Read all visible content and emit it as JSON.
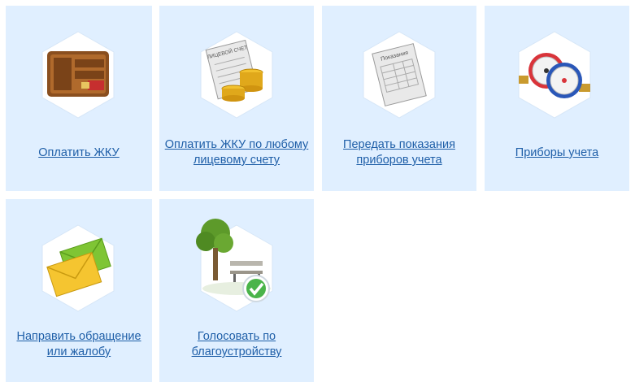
{
  "tiles": [
    {
      "label": "Оплатить ЖКУ",
      "icon": "wallet-icon"
    },
    {
      "label": "Оплатить ЖКУ по любому лицевому счету",
      "icon": "account-coins-icon",
      "icon_text": "ЛИЦЕВОЙ СЧЕТ"
    },
    {
      "label": "Передать показания приборов учета",
      "icon": "meter-readings-form-icon",
      "icon_text": "Показания"
    },
    {
      "label": "Приборы учета",
      "icon": "water-meters-icon"
    },
    {
      "label": "Направить обращение или жалобу",
      "icon": "envelopes-icon"
    },
    {
      "label": "Голосовать по благоустройству",
      "icon": "park-vote-icon"
    }
  ],
  "colors": {
    "tile_bg": "#e0efff",
    "link": "#1f5fa8",
    "hex_bg": "#ffffff"
  }
}
